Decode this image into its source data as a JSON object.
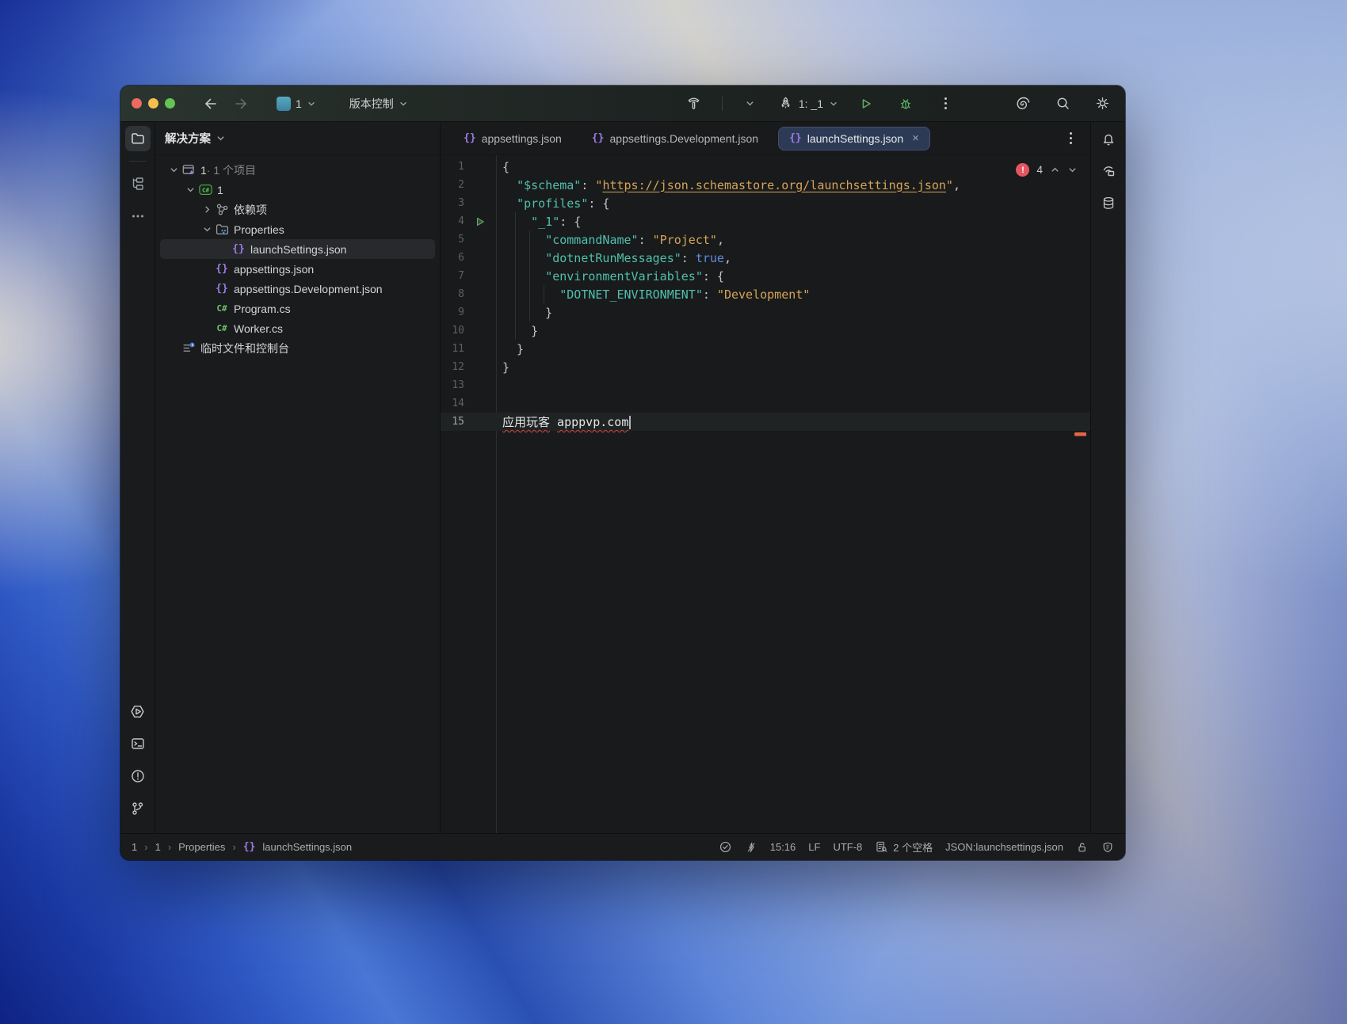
{
  "titlebar": {
    "project_number": "1",
    "vcs": "版本控制",
    "run_config": "1: _1"
  },
  "explorer": {
    "header": "解决方案",
    "items": [
      {
        "depth": 0,
        "chevron": "down",
        "icon": "solution",
        "label": "1",
        "label_dim": " · 1 个项目"
      },
      {
        "depth": 1,
        "chevron": "down",
        "icon": "csproj",
        "label": "1"
      },
      {
        "depth": 2,
        "chevron": "right",
        "icon": "deps",
        "label": "依赖项"
      },
      {
        "depth": 2,
        "chevron": "down",
        "icon": "folder_props",
        "label": "Properties"
      },
      {
        "depth": 3,
        "chevron": "none",
        "icon": "json",
        "label": "launchSettings.json",
        "selected": true
      },
      {
        "depth": 2,
        "chevron": "none",
        "icon": "json",
        "label": "appsettings.json"
      },
      {
        "depth": 2,
        "chevron": "none",
        "icon": "json",
        "label": "appsettings.Development.json"
      },
      {
        "depth": 2,
        "chevron": "none",
        "icon": "cs",
        "label": "Program.cs"
      },
      {
        "depth": 2,
        "chevron": "none",
        "icon": "cs",
        "label": "Worker.cs"
      },
      {
        "depth": 0,
        "chevron": "none",
        "icon": "scratch",
        "label": "临时文件和控制台"
      }
    ]
  },
  "tabs": [
    {
      "label": "appsettings.json",
      "active": false
    },
    {
      "label": "appsettings.Development.json",
      "active": false
    },
    {
      "label": "launchSettings.json",
      "active": true
    }
  ],
  "editor": {
    "error_count": "4",
    "lines": [
      {
        "n": "1",
        "tokens": [
          {
            "t": "{",
            "c": "p"
          }
        ]
      },
      {
        "n": "2",
        "tokens": [
          {
            "t": "  ",
            "c": "p"
          },
          {
            "t": "\"$schema\"",
            "c": "k"
          },
          {
            "t": ": ",
            "c": "p"
          },
          {
            "t": "\"",
            "c": "s"
          },
          {
            "t": "https://json.schemastore.org/launchsettings.json",
            "c": "su"
          },
          {
            "t": "\"",
            "c": "s"
          },
          {
            "t": ",",
            "c": "p"
          }
        ]
      },
      {
        "n": "3",
        "tokens": [
          {
            "t": "  ",
            "c": "p"
          },
          {
            "t": "\"profiles\"",
            "c": "k"
          },
          {
            "t": ": {",
            "c": "p"
          }
        ]
      },
      {
        "n": "4",
        "run": true,
        "tokens": [
          {
            "t": "    ",
            "c": "p"
          },
          {
            "t": "\"_1\"",
            "c": "k"
          },
          {
            "t": ": {",
            "c": "p"
          }
        ]
      },
      {
        "n": "5",
        "tokens": [
          {
            "t": "      ",
            "c": "p"
          },
          {
            "t": "\"commandName\"",
            "c": "k"
          },
          {
            "t": ": ",
            "c": "p"
          },
          {
            "t": "\"Project\"",
            "c": "s"
          },
          {
            "t": ",",
            "c": "p"
          }
        ]
      },
      {
        "n": "6",
        "tokens": [
          {
            "t": "      ",
            "c": "p"
          },
          {
            "t": "\"dotnetRunMessages\"",
            "c": "k"
          },
          {
            "t": ": ",
            "c": "p"
          },
          {
            "t": "true",
            "c": "b"
          },
          {
            "t": ",",
            "c": "p"
          }
        ]
      },
      {
        "n": "7",
        "tokens": [
          {
            "t": "      ",
            "c": "p"
          },
          {
            "t": "\"environmentVariables\"",
            "c": "k"
          },
          {
            "t": ": {",
            "c": "p"
          }
        ]
      },
      {
        "n": "8",
        "tokens": [
          {
            "t": "        ",
            "c": "p"
          },
          {
            "t": "\"DOTNET_ENVIRONMENT\"",
            "c": "k"
          },
          {
            "t": ": ",
            "c": "p"
          },
          {
            "t": "\"Development\"",
            "c": "s"
          }
        ]
      },
      {
        "n": "9",
        "tokens": [
          {
            "t": "      }",
            "c": "p"
          }
        ]
      },
      {
        "n": "10",
        "tokens": [
          {
            "t": "    }",
            "c": "p"
          }
        ]
      },
      {
        "n": "11",
        "tokens": [
          {
            "t": "  }",
            "c": "p"
          }
        ]
      },
      {
        "n": "12",
        "tokens": [
          {
            "t": "}",
            "c": "p"
          }
        ]
      },
      {
        "n": "13",
        "tokens": []
      },
      {
        "n": "14",
        "tokens": []
      },
      {
        "n": "15",
        "current": true,
        "caret": true,
        "tokens": [
          {
            "t": "应用玩客",
            "c": "terr"
          },
          {
            "t": " ",
            "c": "t"
          },
          {
            "t": "apppvp.com",
            "c": "terr"
          }
        ]
      }
    ]
  },
  "statusbar": {
    "breadcrumbs": [
      "1",
      "1",
      "Properties"
    ],
    "breadcrumb_file": "launchSettings.json",
    "caret": "15:16",
    "line_sep": "LF",
    "encoding": "UTF-8",
    "indent": "2 个空格",
    "filetype": "JSON:launchsettings.json"
  },
  "colors": {
    "active_tab_bg": "#2d3a55",
    "error_red": "#e55561",
    "stripe_orange": "#e2664d",
    "run_green": "#5fb365",
    "json_purple": "#9d7ae8",
    "key_teal": "#4fc0ad",
    "string_gold": "#d5a458",
    "bool_blue": "#5d8ce0",
    "project_badge_teal": "#4b9cb5"
  }
}
